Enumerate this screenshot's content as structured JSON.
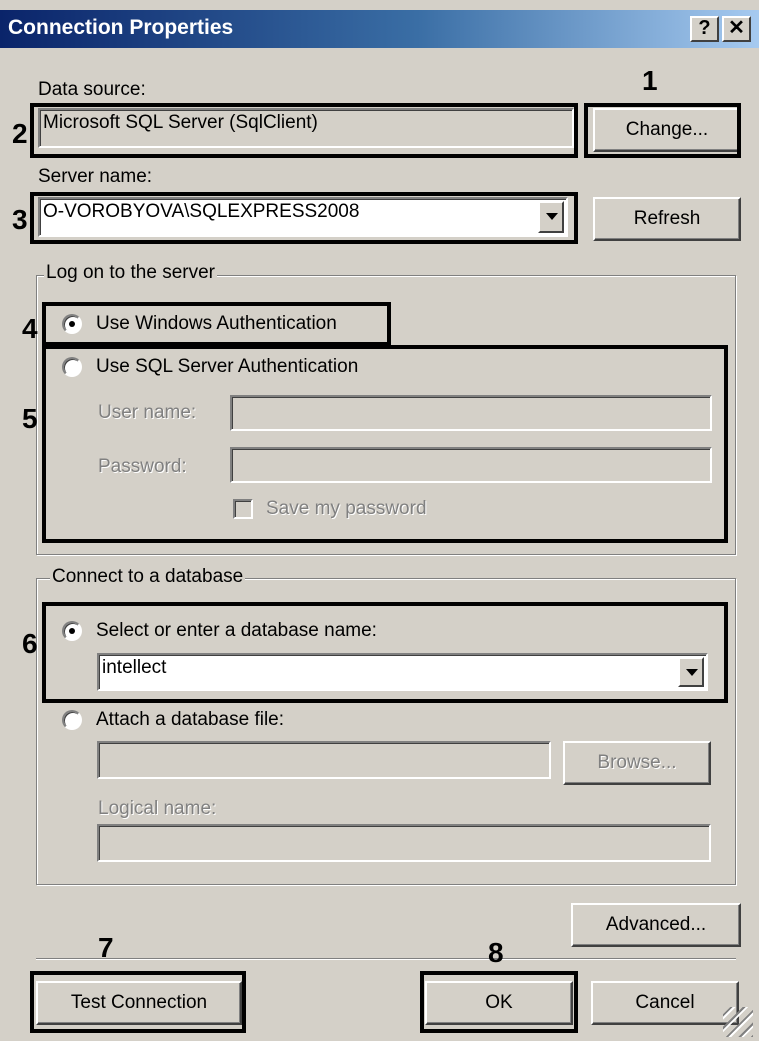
{
  "window": {
    "title": "Connection Properties",
    "help_btn": "?",
    "close_btn": "✕"
  },
  "data_source": {
    "label": "Data source:",
    "value": "Microsoft SQL Server (SqlClient)",
    "change_btn": "Change..."
  },
  "server": {
    "label": "Server name:",
    "value": "O-VOROBYOVA\\SQLEXPRESS2008",
    "refresh_btn": "Refresh"
  },
  "logon": {
    "legend": "Log on to the server",
    "windows_auth": "Use Windows Authentication",
    "sql_auth": "Use SQL Server Authentication",
    "username_label": "User name:",
    "password_label": "Password:",
    "save_password": "Save my password",
    "selected": "windows"
  },
  "database": {
    "legend": "Connect to a database",
    "select_label": "Select or enter a database name:",
    "db_value": "intellect",
    "attach_label": "Attach a database file:",
    "browse_btn": "Browse...",
    "logical_label": "Logical name:",
    "selected": "select"
  },
  "footer": {
    "advanced_btn": "Advanced...",
    "test_btn": "Test Connection",
    "ok_btn": "OK",
    "cancel_btn": "Cancel"
  },
  "annotations": [
    "1",
    "2",
    "3",
    "4",
    "5",
    "6",
    "7",
    "8"
  ]
}
